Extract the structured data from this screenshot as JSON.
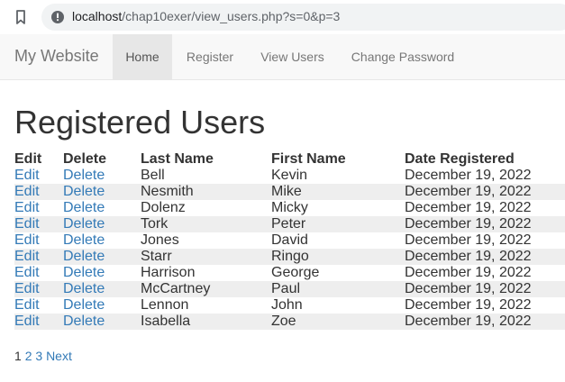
{
  "browser": {
    "url_host": "localhost",
    "url_path": "/chap10exer/view_users.php?s=0&p=3"
  },
  "navbar": {
    "brand": "My Website",
    "items": [
      {
        "label": "Home",
        "active": true
      },
      {
        "label": "Register",
        "active": false
      },
      {
        "label": "View Users",
        "active": false
      },
      {
        "label": "Change Password",
        "active": false
      }
    ]
  },
  "page": {
    "title": "Registered Users"
  },
  "table": {
    "headers": [
      "Edit",
      "Delete",
      "Last Name",
      "First Name",
      "Date Registered"
    ],
    "rows": [
      {
        "edit": "Edit",
        "delete": "Delete",
        "last": "Bell",
        "first": "Kevin",
        "date": "December 19, 2022"
      },
      {
        "edit": "Edit",
        "delete": "Delete",
        "last": "Nesmith",
        "first": "Mike",
        "date": "December 19, 2022"
      },
      {
        "edit": "Edit",
        "delete": "Delete",
        "last": "Dolenz",
        "first": "Micky",
        "date": "December 19, 2022"
      },
      {
        "edit": "Edit",
        "delete": "Delete",
        "last": "Tork",
        "first": "Peter",
        "date": "December 19, 2022"
      },
      {
        "edit": "Edit",
        "delete": "Delete",
        "last": "Jones",
        "first": "David",
        "date": "December 19, 2022"
      },
      {
        "edit": "Edit",
        "delete": "Delete",
        "last": "Starr",
        "first": "Ringo",
        "date": "December 19, 2022"
      },
      {
        "edit": "Edit",
        "delete": "Delete",
        "last": "Harrison",
        "first": "George",
        "date": "December 19, 2022"
      },
      {
        "edit": "Edit",
        "delete": "Delete",
        "last": "McCartney",
        "first": "Paul",
        "date": "December 19, 2022"
      },
      {
        "edit": "Edit",
        "delete": "Delete",
        "last": "Lennon",
        "first": "John",
        "date": "December 19, 2022"
      },
      {
        "edit": "Edit",
        "delete": "Delete",
        "last": "Isabella",
        "first": "Zoe",
        "date": "December 19, 2022"
      }
    ]
  },
  "pagination": {
    "current": "1",
    "pages": [
      "2",
      "3"
    ],
    "next": "Next"
  },
  "colors": {
    "link": "#337ab7",
    "stripe": "#eeeeee",
    "navbar_bg": "#f8f8f8",
    "nav_active_bg": "#e7e7e7"
  },
  "icons": {
    "bookmark": "bookmark-icon",
    "site_info": "info-icon"
  }
}
